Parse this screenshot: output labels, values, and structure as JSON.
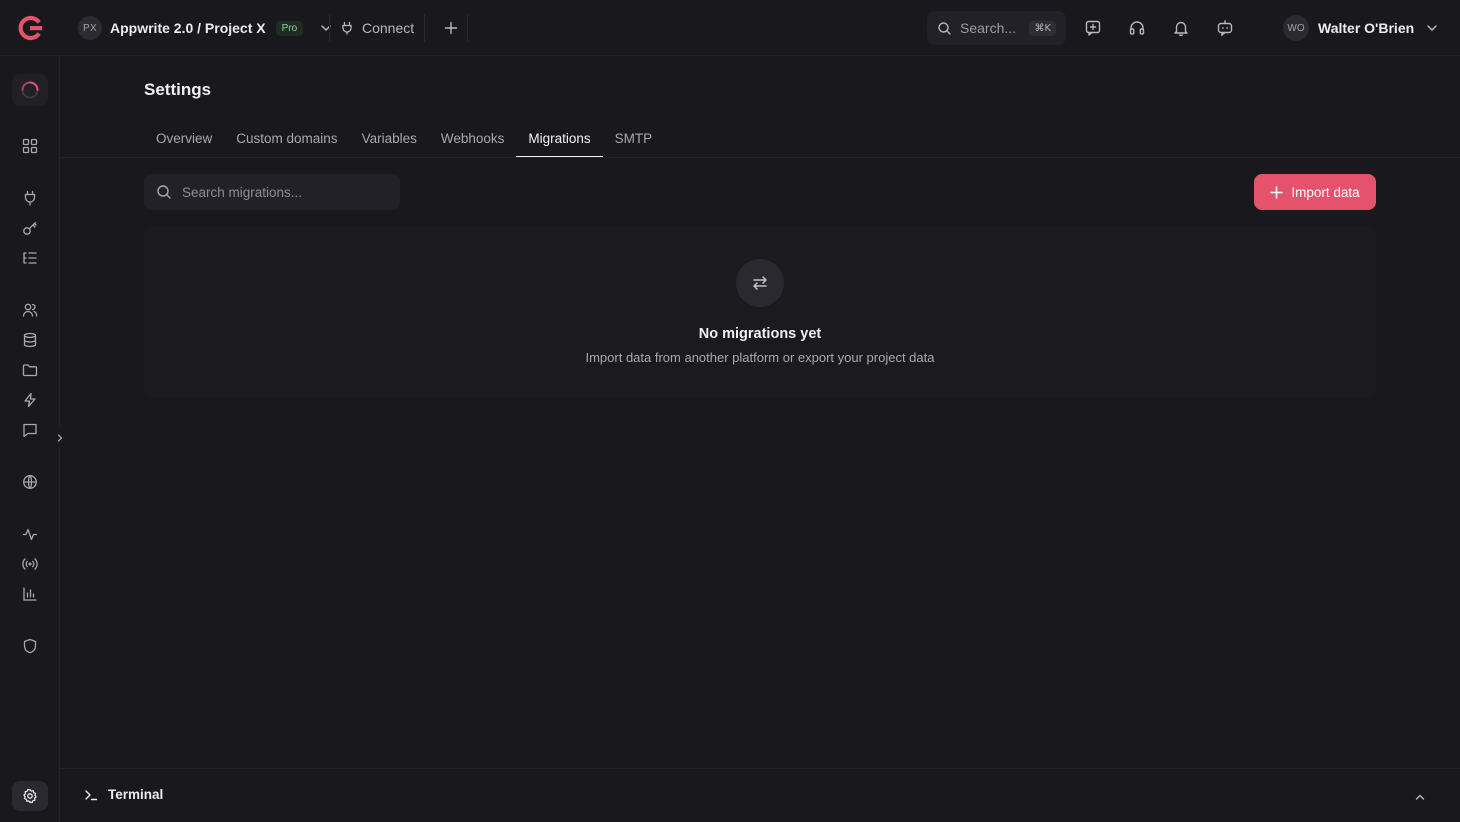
{
  "colors": {
    "background": "#19181d",
    "accent": "#e4526c",
    "text": "#e6e6e8",
    "muted": "#a9a8ae",
    "pro_badge": "#86d3a4"
  },
  "topbar": {
    "project_initials": "PX",
    "project_name": "Appwrite 2.0 / Project X",
    "plan_badge": "Pro",
    "connect_label": "Connect",
    "search_label": "Search...",
    "search_shortcut": "⌘K",
    "icons": [
      "feedback-icon",
      "support-icon",
      "notifications-icon",
      "assistant-icon"
    ],
    "user_initials": "WO",
    "user_name": "Walter O'Brien"
  },
  "sidebar": {
    "items": [
      "loading-icon",
      "overview-icon",
      "integrations-icon",
      "api-keys-icon",
      "platforms-icon",
      "auth-icon",
      "databases-icon",
      "storage-icon",
      "functions-icon",
      "messaging-icon",
      "sites-icon",
      "activity-icon",
      "realtime-icon",
      "usage-icon",
      "security-icon",
      "settings-icon"
    ]
  },
  "page": {
    "title": "Settings",
    "tabs": [
      {
        "label": "Overview",
        "active": false
      },
      {
        "label": "Custom domains",
        "active": false
      },
      {
        "label": "Variables",
        "active": false
      },
      {
        "label": "Webhooks",
        "active": false
      },
      {
        "label": "Migrations",
        "active": true
      },
      {
        "label": "SMTP",
        "active": false
      }
    ],
    "search_placeholder": "Search migrations...",
    "import_button": "Import data",
    "empty_title": "No migrations yet",
    "empty_subtitle": "Import data from another platform or export your project data"
  },
  "terminal": {
    "label": "Terminal"
  }
}
